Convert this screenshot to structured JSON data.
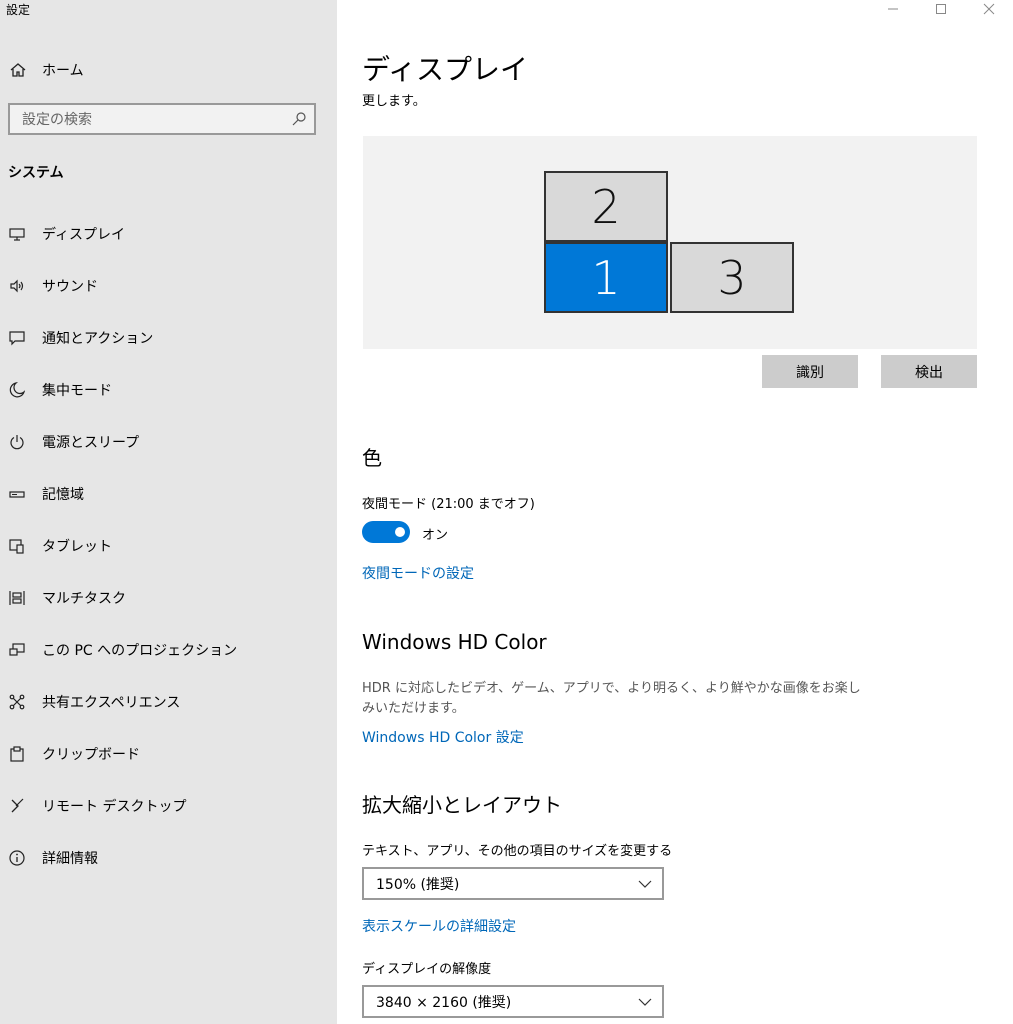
{
  "window": {
    "title": "設定",
    "controls": {
      "minimize": "—",
      "maximize": "☐",
      "close": "✕"
    }
  },
  "sidebar": {
    "home_label": "ホーム",
    "search_placeholder": "設定の検索",
    "section_label": "システム",
    "items": [
      {
        "label": "ディスプレイ",
        "icon": "monitor-icon"
      },
      {
        "label": "サウンド",
        "icon": "speaker-icon"
      },
      {
        "label": "通知とアクション",
        "icon": "notification-icon"
      },
      {
        "label": "集中モード",
        "icon": "moon-icon"
      },
      {
        "label": "電源とスリープ",
        "icon": "power-icon"
      },
      {
        "label": "記憶域",
        "icon": "storage-icon"
      },
      {
        "label": "タブレット",
        "icon": "tablet-icon"
      },
      {
        "label": "マルチタスク",
        "icon": "multitask-icon"
      },
      {
        "label": "この PC へのプロジェクション",
        "icon": "projection-icon"
      },
      {
        "label": "共有エクスペリエンス",
        "icon": "share-icon"
      },
      {
        "label": "クリップボード",
        "icon": "clipboard-icon"
      },
      {
        "label": "リモート デスクトップ",
        "icon": "remote-icon"
      },
      {
        "label": "詳細情報",
        "icon": "info-icon"
      }
    ]
  },
  "main": {
    "title": "ディスプレイ",
    "subtitle": "更します。",
    "monitors": [
      {
        "number": "2",
        "selected": false
      },
      {
        "number": "1",
        "selected": true
      },
      {
        "number": "3",
        "selected": false
      }
    ],
    "identify_button": "識別",
    "detect_button": "検出",
    "color": {
      "heading": "色",
      "night_mode_label": "夜間モード (21:00 までオフ)",
      "toggle_state": "オン",
      "night_mode_link": "夜間モードの設定"
    },
    "hdr": {
      "heading": "Windows HD Color",
      "description": "HDR に対応したビデオ、ゲーム、アプリで、より明るく、より鮮やかな画像をお楽しみいただけます。",
      "link": "Windows HD Color 設定"
    },
    "scale": {
      "heading": "拡大縮小とレイアウト",
      "size_label": "テキスト、アプリ、その他の項目のサイズを変更する",
      "size_value": "150% (推奨)",
      "advanced_link": "表示スケールの詳細設定",
      "resolution_label": "ディスプレイの解像度",
      "resolution_value": "3840 × 2160 (推奨)"
    }
  },
  "colors": {
    "accent": "#0078d7",
    "link": "#0067b8",
    "sidebar_bg": "#e6e6e6"
  }
}
